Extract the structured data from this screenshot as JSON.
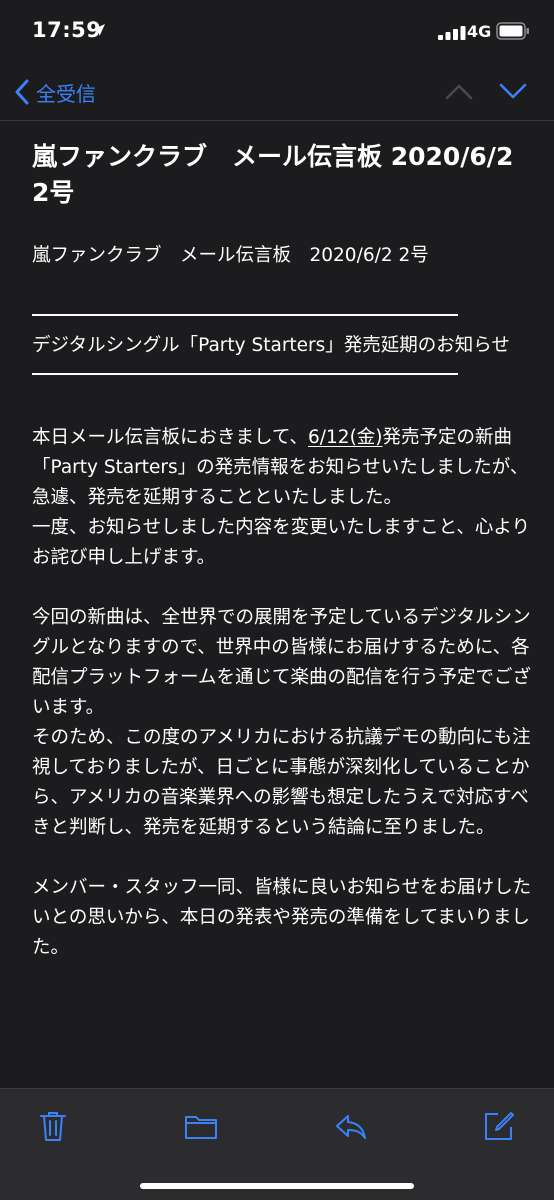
{
  "status_bar": {
    "time": "17:59",
    "network": "4G",
    "icons": [
      "location-arrow-icon",
      "cellular-signal-icon",
      "battery-icon"
    ]
  },
  "nav": {
    "back_label": "全受信",
    "icons": [
      "chevron-left-icon",
      "chevron-up-icon",
      "chevron-down-icon"
    ]
  },
  "email": {
    "subject": "嵐ファンクラブ　メール伝言板 2020/6/2 2号",
    "header_line": "嵐ファンクラブ　メール伝言板　2020/6/2 2号",
    "notice_title": "デジタルシングル「Party Starters」発売延期のお知らせ",
    "p1_pre": "本日メール伝言板におきまして、",
    "p1_date": "6/12(金)",
    "p1_post": "発売予定の新曲「Party Starters」の発売情報をお知らせいたしましたが、急遽、発売を延期することといたしました。\n一度、お知らせしました内容を変更いたしますこと、心よりお詫び申し上げます。",
    "p2": "今回の新曲は、全世界での展開を予定しているデジタルシングルとなりますので、世界中の皆様にお届けするために、各配信プラットフォームを通じて楽曲の配信を行う予定でございます。\nそのため、この度のアメリカにおける抗議デモの動向にも注視しておりましたが、日ごとに事態が深刻化していることから、アメリカの音楽業界への影響も想定したうえで対応すべきと判断し、発売を延期するという結論に至りました。",
    "p3": "メンバー・スタッフ一同、皆様に良いお知らせをお届けしたいとの思いから、本日の発表や発売の準備をしてまいりました。"
  },
  "toolbar": {
    "icons": [
      "trash-icon",
      "folder-icon",
      "reply-icon",
      "compose-icon"
    ]
  },
  "colors": {
    "accent": "#3a82f7",
    "background": "#1c1c1e",
    "toolbar": "#2c2c2e",
    "text": "#ffffff"
  }
}
